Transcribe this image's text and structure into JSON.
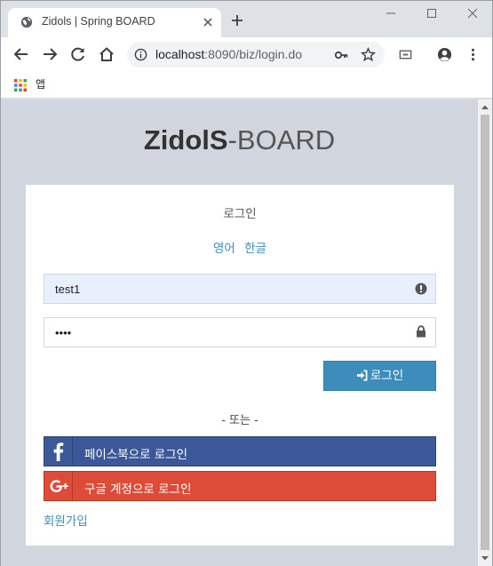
{
  "browser": {
    "tab_title": "Zidols | Spring BOARD",
    "url_host": "localhost",
    "url_rest": ":8090/biz/login.do",
    "bookmarks_apps_label": "앱"
  },
  "page": {
    "logo_bold": "ZidolS",
    "logo_light": "-BOARD",
    "login_title": "로그인",
    "lang_english": "영어",
    "lang_korean": "한글",
    "id_value": "test1",
    "password_value": "••••",
    "login_button": "로그인",
    "or_divider": "- 또는 -",
    "facebook_login": "페이스북으로 로그인",
    "google_login": "구글 계정으로 로그인",
    "signup_link": "회원가입"
  },
  "colors": {
    "page_bg": "#d1d5de",
    "primary": "#3c8dbc",
    "facebook": "#3b5998",
    "google": "#dd4b39"
  }
}
